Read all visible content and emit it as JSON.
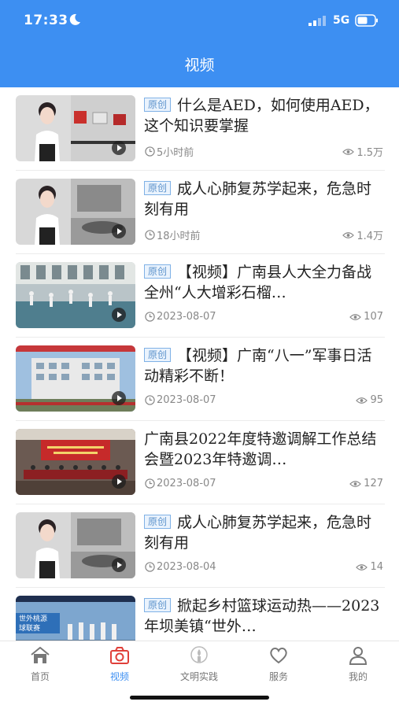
{
  "status_bar": {
    "time": "17:33",
    "network": "5G"
  },
  "header": {
    "title": "视频"
  },
  "badge_label": "原创",
  "items": [
    {
      "badge": true,
      "title": "什么是AED，如何使用AED，这个知识要掌握",
      "time": "5小时前",
      "views": "1.5万"
    },
    {
      "badge": true,
      "title": "成人心肺复苏学起来，危急时刻有用",
      "time": "18小时前",
      "views": "1.4万"
    },
    {
      "badge": true,
      "title": "【视频】广南县人大全力备战全州“人大增彩石榴…",
      "time": "2023-08-07",
      "views": "107"
    },
    {
      "badge": true,
      "title": "【视频】广南“八一”军事日活动精彩不断！",
      "time": "2023-08-07",
      "views": "95"
    },
    {
      "badge": false,
      "title": "广南县2022年度特邀调解工作总结会暨2023年特邀调…",
      "time": "2023-08-07",
      "views": "127"
    },
    {
      "badge": true,
      "title": "成人心肺复苏学起来，危急时刻有用",
      "time": "2023-08-04",
      "views": "14"
    },
    {
      "badge": true,
      "title": "掀起乡村篮球运动热——2023年坝美镇“世外…",
      "time": "",
      "views": ""
    }
  ],
  "thumb_texts": {
    "item7_banner": "世外桃源",
    "item7_sub": "球联赛"
  },
  "tabbar": [
    {
      "label": "首页",
      "icon": "home-icon"
    },
    {
      "label": "视频",
      "icon": "camera-icon"
    },
    {
      "label": "文明实践",
      "icon": "civilization-icon"
    },
    {
      "label": "服务",
      "icon": "heart-icon"
    },
    {
      "label": "我的",
      "icon": "user-icon"
    }
  ],
  "colors": {
    "accent": "#3d8ff2",
    "badge_border": "#7fb1e6",
    "badge_text": "#5d93cc"
  }
}
